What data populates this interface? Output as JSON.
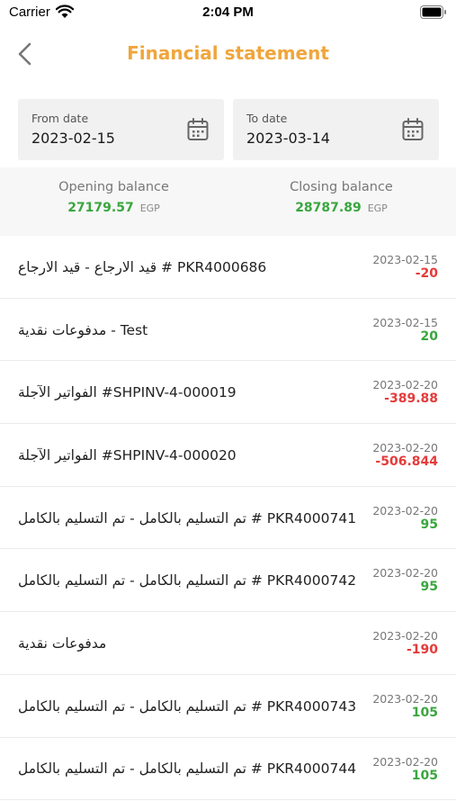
{
  "status_bar": {
    "carrier": "Carrier",
    "time": "2:04 PM"
  },
  "header": {
    "title": "Financial statement",
    "back_icon": "chevron-left-icon"
  },
  "filters": {
    "from": {
      "label": "From date",
      "value": "2023-02-15",
      "icon": "calendar-icon"
    },
    "to": {
      "label": "To date",
      "value": "2023-03-14",
      "icon": "calendar-icon"
    }
  },
  "balances": {
    "opening": {
      "label": "Opening balance",
      "value": "27179.57",
      "currency": "EGP"
    },
    "closing": {
      "label": "Closing balance",
      "value": "28787.89",
      "currency": "EGP"
    }
  },
  "colors": {
    "accent": "#f0a63c",
    "positive": "#3aa63f",
    "negative": "#e43b3b"
  },
  "transactions": [
    {
      "description": "قيد الارجاع - قيد الارجاع # PKR4000686",
      "date": "2023-02-15",
      "amount": "-20",
      "sign": "negative"
    },
    {
      "description": "مدفوعات نقدية - Test",
      "date": "2023-02-15",
      "amount": "20",
      "sign": "positive"
    },
    {
      "description": "الفواتير الآجلة #SHPINV-4-000019",
      "date": "2023-02-20",
      "amount": "-389.88",
      "sign": "negative"
    },
    {
      "description": "الفواتير الآجلة #SHPINV-4-000020",
      "date": "2023-02-20",
      "amount": "-506.844",
      "sign": "negative"
    },
    {
      "description": "تم التسليم بالكامل - تم التسليم بالكامل # PKR4000741",
      "date": "2023-02-20",
      "amount": "95",
      "sign": "positive"
    },
    {
      "description": "تم التسليم بالكامل - تم التسليم بالكامل # PKR4000742",
      "date": "2023-02-20",
      "amount": "95",
      "sign": "positive"
    },
    {
      "description": "مدفوعات نقدية",
      "date": "2023-02-20",
      "amount": "-190",
      "sign": "negative"
    },
    {
      "description": "تم التسليم بالكامل - تم التسليم بالكامل # PKR4000743",
      "date": "2023-02-20",
      "amount": "105",
      "sign": "positive"
    },
    {
      "description": "تم التسليم بالكامل - تم التسليم بالكامل # PKR4000744",
      "date": "2023-02-20",
      "amount": "105",
      "sign": "positive"
    }
  ]
}
